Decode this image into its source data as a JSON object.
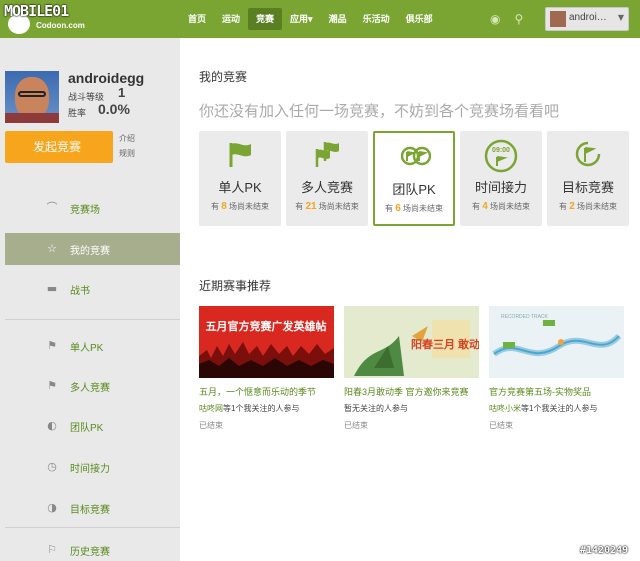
{
  "logo": {
    "wordmark": "MOBILE01",
    "subtitle": "Codoon.com"
  },
  "nav": {
    "items": [
      "首页",
      "运动",
      "竞赛",
      "应用▾",
      "潮品",
      "乐活动",
      "俱乐部"
    ],
    "active_index": 2
  },
  "topbar": {
    "user_name": "androi…",
    "eye_icon": "eye-icon",
    "search_icon": "search-icon"
  },
  "profile": {
    "name": "androidegg",
    "level_label": "战斗等级",
    "level_value": "1",
    "rate_label": "胜率",
    "rate_value": "0.0%"
  },
  "actions": {
    "start_label": "发起竞赛",
    "intro_link": "介绍",
    "rules_link": "规则"
  },
  "sidebar_menu": [
    {
      "label": "竞赛场",
      "icon": "arena-icon"
    },
    {
      "label": "我的竞赛",
      "icon": "star-icon",
      "active": true
    },
    {
      "label": "战书",
      "icon": "book-icon"
    },
    {
      "label": "单人PK",
      "icon": "flag-icon"
    },
    {
      "label": "多人竞赛",
      "icon": "flags-icon"
    },
    {
      "label": "团队PK",
      "icon": "team-icon"
    },
    {
      "label": "时间接力",
      "icon": "clock-icon"
    },
    {
      "label": "目标竞赛",
      "icon": "target-icon"
    },
    {
      "label": "历史竞赛",
      "icon": "history-icon"
    }
  ],
  "main": {
    "title": "我的竞赛",
    "prompt": "你还没有加入任何一场竞赛，不妨到各个竞赛场看看吧",
    "categories": [
      {
        "title": "单人PK",
        "prefix": "有",
        "count": "8",
        "suffix": "场尚未结束"
      },
      {
        "title": "多人竞赛",
        "prefix": "有",
        "count": "21",
        "suffix": "场尚未结束"
      },
      {
        "title": "团队PK",
        "prefix": "有",
        "count": "6",
        "suffix": "场尚未结束"
      },
      {
        "title": "时间接力",
        "prefix": "有",
        "count": "4",
        "suffix": "场尚未结束",
        "clock_text": "09:00"
      },
      {
        "title": "目标竞赛",
        "prefix": "有",
        "count": "2",
        "suffix": "场尚未结束"
      }
    ],
    "recent_title": "近期赛事推荐",
    "recent": [
      {
        "banner": "五月官方竞赛广发英雄帖",
        "title": "五月，一个惬意而乐动的季节",
        "host": "咕咚网",
        "host_suffix": "等1个我关注的人参与",
        "status": "已结束"
      },
      {
        "banner": "阳春三月 敢动季",
        "title": "阳春3月敢动季 官方邀你来竞赛",
        "host": "",
        "host_suffix": "暂无关注的人参与",
        "status": "已结束"
      },
      {
        "banner": "RECORDED TRACK",
        "title": "官方竞赛第五场-实物奖品",
        "host": "咕咚小米",
        "host_suffix": "等1个我关注的人参与",
        "status": "已结束"
      }
    ]
  },
  "watermark": "#1420249",
  "colors": {
    "brand_green": "#7ba532",
    "accent_orange": "#f7a51c",
    "link_green": "#5a8a1e"
  }
}
